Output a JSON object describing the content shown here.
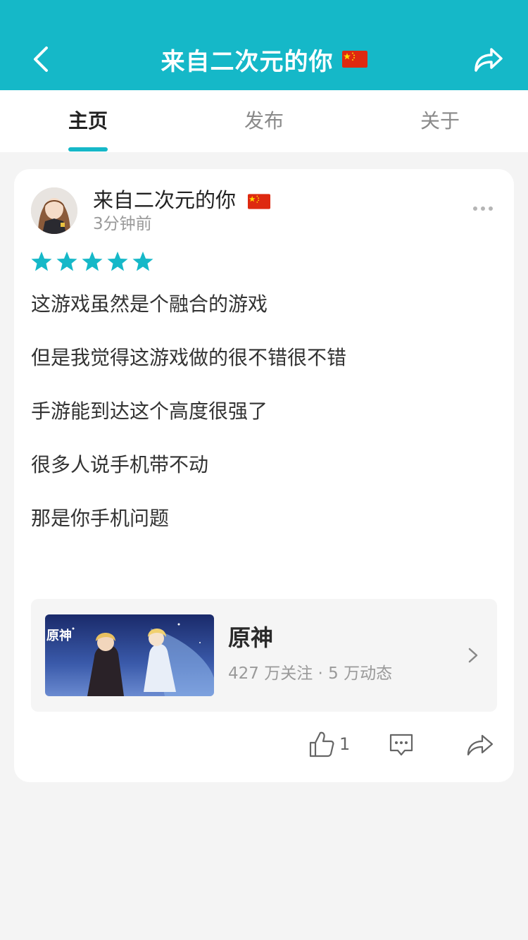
{
  "header": {
    "title": "来自二次元的你",
    "flag": "china-flag",
    "back_icon": "back-chevron-icon",
    "share_icon": "share-icon",
    "background": "#15b8c8"
  },
  "tabs": [
    {
      "label": "主页",
      "active": true
    },
    {
      "label": "发布",
      "active": false
    },
    {
      "label": "关于",
      "active": false
    }
  ],
  "post": {
    "author": "来自二次元的你",
    "author_flag": "china-flag",
    "time": "3分钟前",
    "rating": 5,
    "lines": [
      "这游戏虽然是个融合的游戏",
      "但是我觉得这游戏做的很不错很不错",
      "手游能到达这个高度很强了",
      "很多人说手机带不动",
      "那是你手机问题"
    ],
    "game": {
      "name": "原神",
      "stats": "427 万关注 · 5 万动态"
    },
    "like_count": "1"
  },
  "colors": {
    "accent": "#15b8c8",
    "star": "#15b8c8"
  }
}
